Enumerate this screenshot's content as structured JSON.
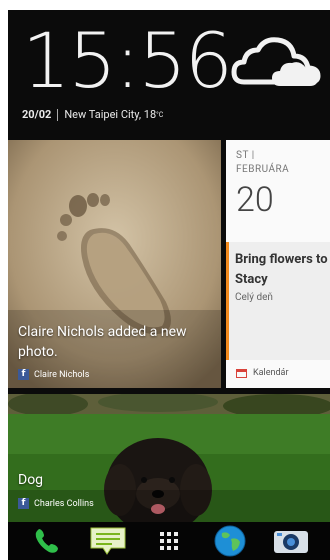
{
  "clock": {
    "time": "15:56",
    "date": "20/02",
    "location": "New Taipei City, 18",
    "temp_unit": "°C",
    "weather_icon": "partly-cloudy-icon"
  },
  "photo_tile": {
    "caption": "Claire Nichols added a new photo.",
    "source": "Claire Nichols",
    "source_icon": "facebook-icon"
  },
  "calendar_tile": {
    "day_of_week": "ST |",
    "month": "FEBRUÁRA",
    "day": "20",
    "event_title": "Bring flowers to Stacy",
    "event_subtitle": "Celý deň",
    "footer": "Kalendár",
    "accent": "#f28a1d"
  },
  "dog_tile": {
    "caption": "Dog",
    "source": "Charles Collins",
    "source_icon": "facebook-icon"
  },
  "dock": {
    "items": [
      "phone-icon",
      "messages-icon",
      "apps-grid-icon",
      "browser-globe-icon",
      "camera-icon"
    ]
  }
}
